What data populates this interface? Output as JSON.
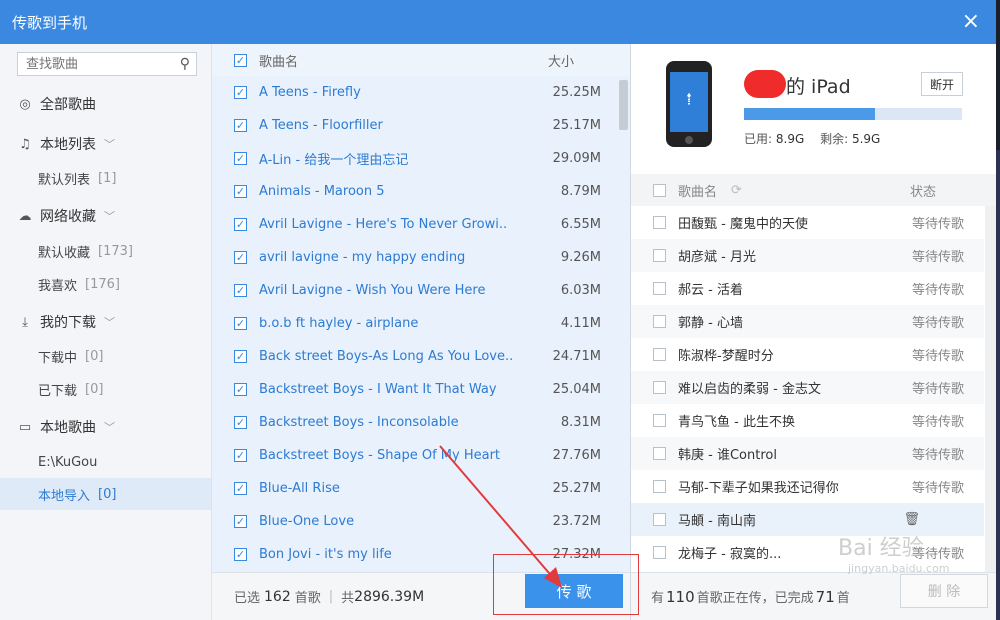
{
  "window": {
    "title": "传歌到手机",
    "close": "×"
  },
  "sidebar": {
    "search_placeholder": "查找歌曲",
    "search_icon": "magnifier-icon",
    "all_songs": "全部歌曲",
    "local_list": {
      "label": "本地列表",
      "items": [
        {
          "label": "默认列表",
          "count": "[1]"
        }
      ]
    },
    "cloud_fav": {
      "label": "网络收藏",
      "items": [
        {
          "label": "默认收藏",
          "count": "[173]"
        },
        {
          "label": "我喜欢",
          "count": "[176]"
        }
      ]
    },
    "downloads": {
      "label": "我的下载",
      "items": [
        {
          "label": "下载中",
          "count": "[0]"
        },
        {
          "label": "已下载",
          "count": "[0]"
        }
      ]
    },
    "local_songs": {
      "label": "本地歌曲",
      "items": [
        {
          "label": "E:\\KuGou",
          "count": ""
        },
        {
          "label": "本地导入",
          "count": "[0]"
        }
      ]
    }
  },
  "song_list": {
    "col_name": "歌曲名",
    "col_size": "大小",
    "rows": [
      {
        "name": "A Teens - Firefly",
        "size": "25.25M"
      },
      {
        "name": "A Teens - Floorfiller",
        "size": "25.17M"
      },
      {
        "name": "A-Lin - 给我一个理由忘记",
        "size": "29.09M"
      },
      {
        "name": "Animals - Maroon 5",
        "size": "8.79M"
      },
      {
        "name": "Avril Lavigne - Here's To Never Growi..",
        "size": "6.55M"
      },
      {
        "name": "avril lavigne - my happy ending",
        "size": "9.26M"
      },
      {
        "name": "Avril Lavigne - Wish You Were Here",
        "size": "6.03M"
      },
      {
        "name": "b.o.b ft hayley - airplane",
        "size": "4.11M"
      },
      {
        "name": "Back street Boys-As Long As You Love..",
        "size": "24.71M"
      },
      {
        "name": "Backstreet Boys - I Want It That Way",
        "size": "25.04M"
      },
      {
        "name": "Backstreet Boys - Inconsolable",
        "size": "8.31M"
      },
      {
        "name": "Backstreet Boys - Shape Of My Heart",
        "size": "27.76M"
      },
      {
        "name": "Blue-All Rise",
        "size": "25.27M"
      },
      {
        "name": "Blue-One Love",
        "size": "23.72M"
      },
      {
        "name": "Bon Jovi - it's my life",
        "size": "27.32M"
      }
    ],
    "footer": {
      "selected_prefix": "已选",
      "selected_count": "162",
      "selected_suffix": "首歌",
      "total_prefix": "共",
      "total_size": "2896.39M"
    },
    "transfer_button": "传 歌"
  },
  "device": {
    "name": "的 iPad",
    "disconnect": "断开",
    "used_label": "已用:",
    "used": "8.9G",
    "free_label": "剩余:",
    "free": "5.9G",
    "used_fraction": 0.6,
    "col_name": "歌曲名",
    "col_status": "状态",
    "rows": [
      {
        "name": "田馥甄 - 魔鬼中的天使",
        "status": "等待传歌"
      },
      {
        "name": "胡彦斌 - 月光",
        "status": "等待传歌"
      },
      {
        "name": "郝云 - 活着",
        "status": "等待传歌"
      },
      {
        "name": "郭静 - 心墙",
        "status": "等待传歌"
      },
      {
        "name": "陈淑桦-梦醒时分",
        "status": "等待传歌"
      },
      {
        "name": "难以启齿的柔弱 - 金志文",
        "status": "等待传歌"
      },
      {
        "name": "青鸟飞鱼 - 此生不换",
        "status": "等待传歌"
      },
      {
        "name": "韩庚 - 谁Control",
        "status": "等待传歌"
      },
      {
        "name": "马郁-下辈子如果我还记得你",
        "status": "等待传歌"
      },
      {
        "name": "马頔 - 南山南",
        "status": ""
      },
      {
        "name": "龙梅子 - 寂寞的...",
        "status": "等待传歌"
      }
    ],
    "footer": {
      "prefix": "有",
      "count": "110",
      "middle": "首歌正在传，已完成",
      "done": "71",
      "suffix": "首"
    },
    "delete_button": "删 除"
  },
  "watermark": {
    "main": "Bai 经验",
    "sub": "jingyan.baidu.com"
  },
  "colors": {
    "accent": "#3a88e0",
    "link": "#2d7bd2",
    "annotation": "#e23b3b"
  }
}
